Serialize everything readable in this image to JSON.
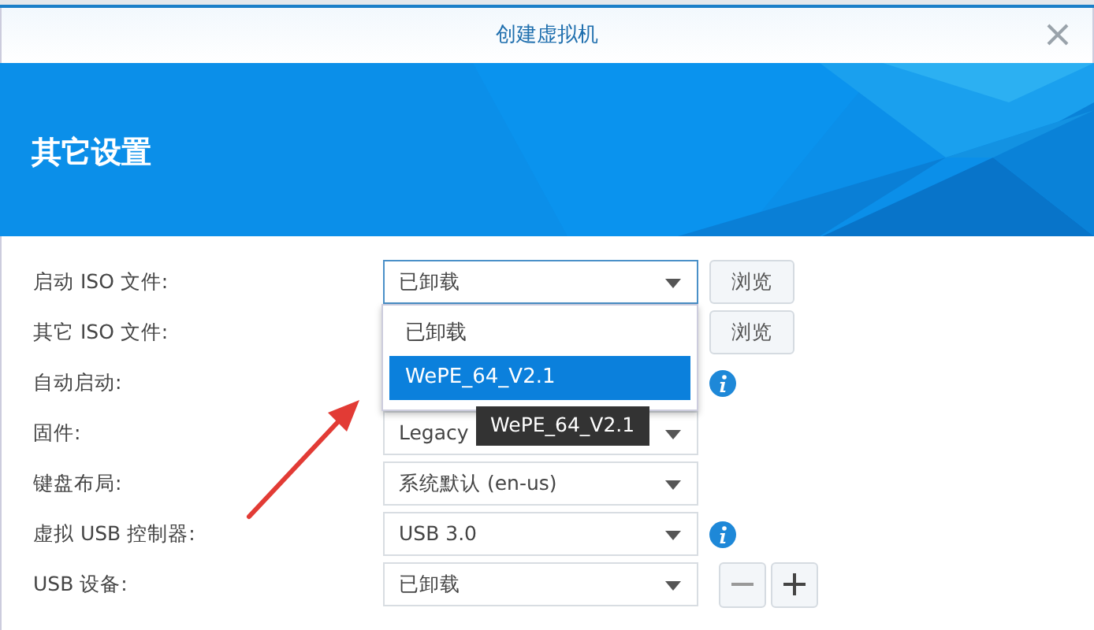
{
  "window": {
    "title": "创建虚拟机"
  },
  "banner": {
    "title": "其它设置"
  },
  "fields": [
    {
      "label": "启动 ISO 文件:",
      "kind": "select",
      "value": "已卸载",
      "focused": true,
      "button": "浏览"
    },
    {
      "label": "其它 ISO 文件:",
      "kind": "hidden",
      "button": "浏览"
    },
    {
      "label": "自动启动:",
      "kind": "hidden",
      "info": true
    },
    {
      "label": "固件:",
      "kind": "select",
      "value": "Legacy"
    },
    {
      "label": "键盘布局:",
      "kind": "select",
      "value": "系统默认 (en-us)"
    },
    {
      "label": "虚拟 USB 控制器:",
      "kind": "select",
      "value": "USB 3.0",
      "info": true
    },
    {
      "label": "USB 设备:",
      "kind": "select",
      "value": "已卸载",
      "stepper": true
    }
  ],
  "dropdown": {
    "options": [
      {
        "label": "已卸载",
        "selected": false
      },
      {
        "label": "WePE_64_V2.1",
        "selected": true
      }
    ]
  },
  "tooltip": "WePE_64_V2.1"
}
